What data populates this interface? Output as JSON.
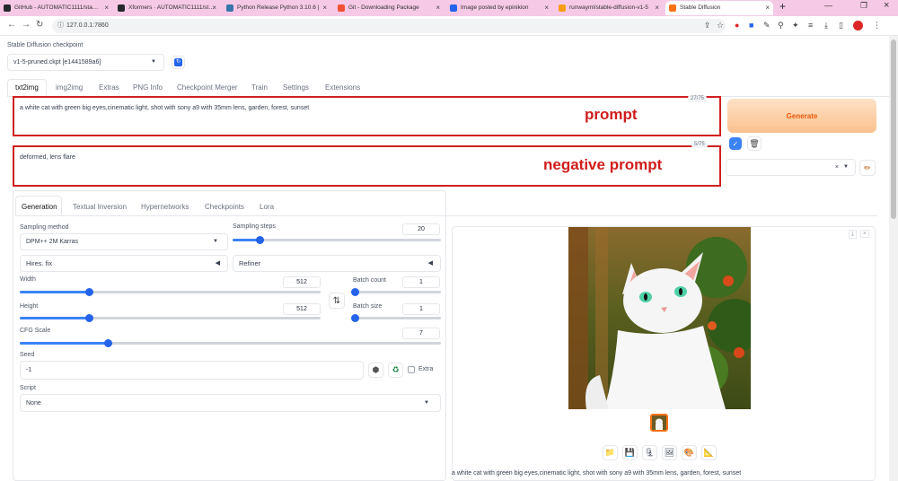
{
  "browser": {
    "tabs": [
      {
        "title": "GitHub - AUTOMATIC1111/sta…",
        "color": "#24292e"
      },
      {
        "title": "Xformers · AUTOMATIC1111/st…",
        "color": "#24292e"
      },
      {
        "title": "Python Release Python 3.10.6 |",
        "color": "#3776ab"
      },
      {
        "title": "Git - Downloading Package",
        "color": "#f05133"
      },
      {
        "title": "Image posted by epinikion",
        "color": "#2563eb"
      },
      {
        "title": "runwayml/stable-diffusion-v1-5",
        "color": "#f59e0b"
      },
      {
        "title": "Stable Diffusion",
        "color": "#f97316"
      }
    ],
    "url": "127.0.0.1:7860"
  },
  "checkpoint": {
    "label": "Stable Diffusion checkpoint",
    "value": "v1-5-pruned.ckpt [e1441589a6]"
  },
  "main_tabs": [
    "txt2img",
    "img2img",
    "Extras",
    "PNG Info",
    "Checkpoint Merger",
    "Train",
    "Settings",
    "Extensions"
  ],
  "prompt": {
    "text": "a white cat with green big eyes,cinematic light, shot with sony a9 with 35mm  lens, garden, forest, sunset",
    "counter": "27/75",
    "annotation": "prompt"
  },
  "negative": {
    "text": "deformed, lens flare",
    "counter": "5/75",
    "annotation": "negative prompt"
  },
  "generate_label": "Generate",
  "sub_tabs": [
    "Generation",
    "Textual Inversion",
    "Hypernetworks",
    "Checkpoints",
    "Lora"
  ],
  "sampling": {
    "method_label": "Sampling method",
    "method": "DPM++ 2M Karras",
    "steps_label": "Sampling steps",
    "steps": "20",
    "steps_fraction": 0.13
  },
  "hires": "Hires. fix",
  "refiner": "Refiner",
  "width": {
    "label": "Width",
    "value": "512",
    "fraction": 0.23
  },
  "height": {
    "label": "Height",
    "value": "512",
    "fraction": 0.23
  },
  "batch_count": {
    "label": "Batch count",
    "value": "1",
    "fraction": 0.02
  },
  "batch_size": {
    "label": "Batch size",
    "value": "1",
    "fraction": 0.02
  },
  "cfg": {
    "label": "CFG Scale",
    "value": "7",
    "fraction": 0.21
  },
  "seed": {
    "label": "Seed",
    "value": "-1",
    "extra": "Extra"
  },
  "script": {
    "label": "Script",
    "value": "None"
  },
  "caption": "a white cat with green big eyes,cinematic light, shot with sony a9 with 35mm lens, garden, forest, sunset",
  "accent": "#3b82f6",
  "annotation_color": "#d01c1c"
}
